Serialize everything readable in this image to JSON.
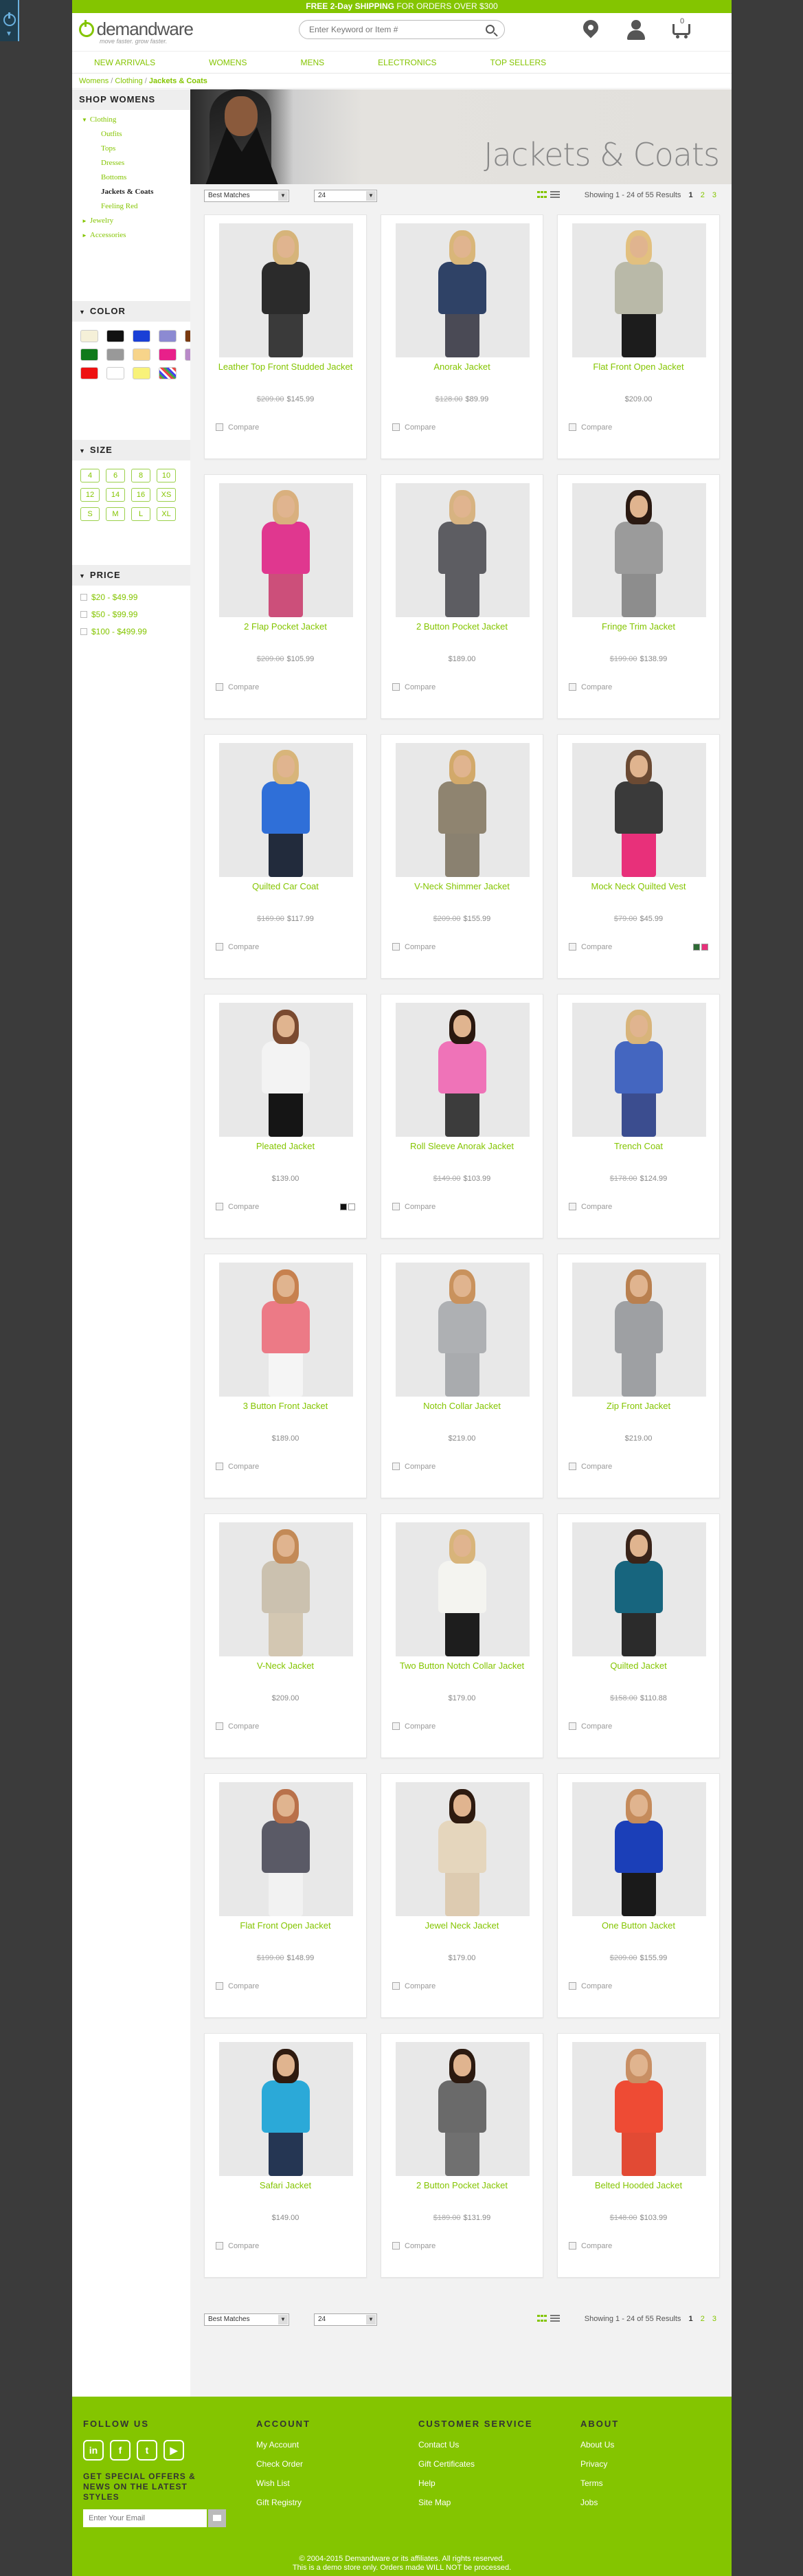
{
  "promo": {
    "bold": "FREE 2-Day SHIPPING",
    "rest": " FOR ORDERS OVER $300"
  },
  "brand": {
    "name": "demandware",
    "tagline": "move faster. grow faster."
  },
  "search": {
    "placeholder": "Enter Keyword or Item #"
  },
  "header": {
    "cart_count": "0"
  },
  "nav": [
    "NEW ARRIVALS",
    "WOMENS",
    "MENS",
    "ELECTRONICS",
    "TOP SELLERS"
  ],
  "breadcrumb": {
    "a": "Womens",
    "b": "Clothing",
    "current": "Jackets & Coats",
    "sep": " / "
  },
  "sidebar": {
    "title": "SHOP WOMENS",
    "categories": [
      {
        "label": "Clothing",
        "level": 0,
        "arrow": "▼"
      },
      {
        "label": "Outfits",
        "level": 1
      },
      {
        "label": "Tops",
        "level": 1
      },
      {
        "label": "Dresses",
        "level": 1
      },
      {
        "label": "Bottoms",
        "level": 1
      },
      {
        "label": "Jackets & Coats",
        "level": 1,
        "active": true
      },
      {
        "label": "Feeling Red",
        "level": 1
      },
      {
        "label": "Jewelry",
        "level": 0,
        "arrow": "►"
      },
      {
        "label": "Accessories",
        "level": 0,
        "arrow": "►"
      }
    ],
    "color_title": "COLOR",
    "colors": [
      "#f5f0d8",
      "#111111",
      "#1a3fd6",
      "#8c8ad2",
      "#7a3a10",
      "#0f7a1a",
      "#999999",
      "#f7d48a",
      "#e8208a",
      "#b98ac8",
      "#ee1111",
      "#ffffff",
      "#f8f27a",
      "#d8d8d8"
    ],
    "size_title": "SIZE",
    "sizes": [
      "4",
      "6",
      "8",
      "10",
      "12",
      "14",
      "16",
      "XS",
      "S",
      "M",
      "L",
      "XL"
    ],
    "price_title": "PRICE",
    "prices": [
      "$20 - $49.99",
      "$50 - $99.99",
      "$100 - $499.99"
    ]
  },
  "banner_title": "Jackets & Coats",
  "toolbar": {
    "sort": "Best Matches",
    "per_page": "24",
    "showing": "Showing 1 - 24 of 55 Results",
    "pages": [
      "1",
      "2",
      "3"
    ]
  },
  "products": [
    {
      "name": "Leather Top Front Studded Jacket",
      "old": "$209.00",
      "price": "$145.99",
      "c": [
        "#2b2b2b",
        "#3a3a3a",
        "#d6b47a"
      ]
    },
    {
      "name": "Anorak Jacket",
      "old": "$128.00",
      "price": "$89.99",
      "c": [
        "#2f4266",
        "#4a4a55",
        "#d9b679"
      ]
    },
    {
      "name": "Flat Front Open Jacket",
      "old": "",
      "price": "$209.00",
      "c": [
        "#b9b9a8",
        "#1c1c1c",
        "#e2c07f"
      ]
    },
    {
      "name": "2 Flap Pocket Jacket",
      "old": "$209.00",
      "price": "$105.99",
      "c": [
        "#e0378f",
        "#cc4f7a",
        "#d9b07e"
      ]
    },
    {
      "name": "2 Button Pocket Jacket",
      "old": "",
      "price": "$189.00",
      "c": [
        "#5d5d62",
        "#5d5d62",
        "#d7b381"
      ]
    },
    {
      "name": "Fringe Trim Jacket",
      "old": "$199.00",
      "price": "$138.99",
      "c": [
        "#9b9b9b",
        "#8d8d8d",
        "#2b1a12"
      ]
    },
    {
      "name": "Quilted Car Coat",
      "old": "$169.00",
      "price": "$117.99",
      "c": [
        "#2f6fd8",
        "#222b3c",
        "#d8b57a"
      ]
    },
    {
      "name": "V-Neck Shimmer Jacket",
      "old": "$209.00",
      "price": "$155.99",
      "c": [
        "#8f8470",
        "#8a8170",
        "#d2a96a"
      ]
    },
    {
      "name": "Mock Neck Quilted Vest",
      "old": "$79.00",
      "price": "$45.99",
      "c": [
        "#3a3a3a",
        "#e8307a",
        "#6b4a33"
      ],
      "sw": [
        "#2e6b35",
        "#e8307a"
      ]
    },
    {
      "name": "Pleated Jacket",
      "old": "",
      "price": "$139.00",
      "c": [
        "#f3f3f3",
        "#151515",
        "#7a4a30"
      ],
      "sw": [
        "#111111",
        "#ffffff"
      ]
    },
    {
      "name": "Roll Sleeve Anorak Jacket",
      "old": "$149.00",
      "price": "$103.99",
      "c": [
        "#ef73b8",
        "#3c3c3c",
        "#2a180f"
      ]
    },
    {
      "name": "Trench Coat",
      "old": "$178.00",
      "price": "$124.99",
      "c": [
        "#4466c0",
        "#3b4d8f",
        "#d8b47a"
      ]
    },
    {
      "name": "3 Button Front Jacket",
      "old": "",
      "price": "$189.00",
      "c": [
        "#ec7a86",
        "#f5f5f5",
        "#c7814f"
      ]
    },
    {
      "name": "Notch Collar Jacket",
      "old": "",
      "price": "$219.00",
      "c": [
        "#aeb0b3",
        "#a9abae",
        "#c9925d"
      ]
    },
    {
      "name": "Zip Front Jacket",
      "old": "",
      "price": "$219.00",
      "c": [
        "#9ea0a3",
        "#9ea0a3",
        "#b9804f"
      ]
    },
    {
      "name": "V-Neck Jacket",
      "old": "",
      "price": "$209.00",
      "c": [
        "#cbc1af",
        "#d3c7b2",
        "#c38a57"
      ]
    },
    {
      "name": "Two Button Notch Collar Jacket",
      "old": "",
      "price": "$179.00",
      "c": [
        "#f4f4f0",
        "#1d1d1d",
        "#d8b47a"
      ]
    },
    {
      "name": "Quilted Jacket",
      "old": "$158.00",
      "price": "$110.88",
      "c": [
        "#17657e",
        "#2b2b2b",
        "#3a2419"
      ]
    },
    {
      "name": "Flat Front Open Jacket",
      "old": "$199.00",
      "price": "$148.99",
      "c": [
        "#5a5a66",
        "#f2f2f2",
        "#b9714a"
      ]
    },
    {
      "name": "Jewel Neck Jacket",
      "old": "",
      "price": "$179.00",
      "c": [
        "#e5d6bd",
        "#ddcbb1",
        "#2e1b10"
      ]
    },
    {
      "name": "One Button Jacket",
      "old": "$209.00",
      "price": "$155.99",
      "c": [
        "#1b3fb8",
        "#1a1a1a",
        "#c58b5b"
      ]
    },
    {
      "name": "Safari Jacket",
      "old": "",
      "price": "$149.00",
      "c": [
        "#2ba9d8",
        "#253653",
        "#2f1b10"
      ]
    },
    {
      "name": "2 Button Pocket Jacket",
      "old": "$189.00",
      "price": "$131.99",
      "c": [
        "#6a6a6a",
        "#707070",
        "#2c1a10"
      ]
    },
    {
      "name": "Belted Hooded Jacket",
      "old": "$148.00",
      "price": "$103.99",
      "c": [
        "#ee4b34",
        "#e24a34",
        "#c88f64"
      ]
    }
  ],
  "compare_label": "Compare",
  "footer": {
    "follow": "FOLLOW US",
    "social": [
      "in",
      "f",
      "t",
      "▶"
    ],
    "signup": "GET SPECIAL OFFERS & NEWS ON THE LATEST STYLES",
    "email_placeholder": "Enter Your Email",
    "account_title": "ACCOUNT",
    "account": [
      "My Account",
      "Check Order",
      "Wish List",
      "Gift Registry"
    ],
    "service_title": "CUSTOMER SERVICE",
    "service": [
      "Contact Us",
      "Gift Certificates",
      "Help",
      "Site Map"
    ],
    "about_title": "ABOUT",
    "about": [
      "About Us",
      "Privacy",
      "Terms",
      "Jobs"
    ],
    "copy1": "© 2004-2015 Demandware or its affiliates. All rights reserved.",
    "copy2": "This is a demo store only. Orders made WILL NOT be processed."
  },
  "accent": "#84c500"
}
